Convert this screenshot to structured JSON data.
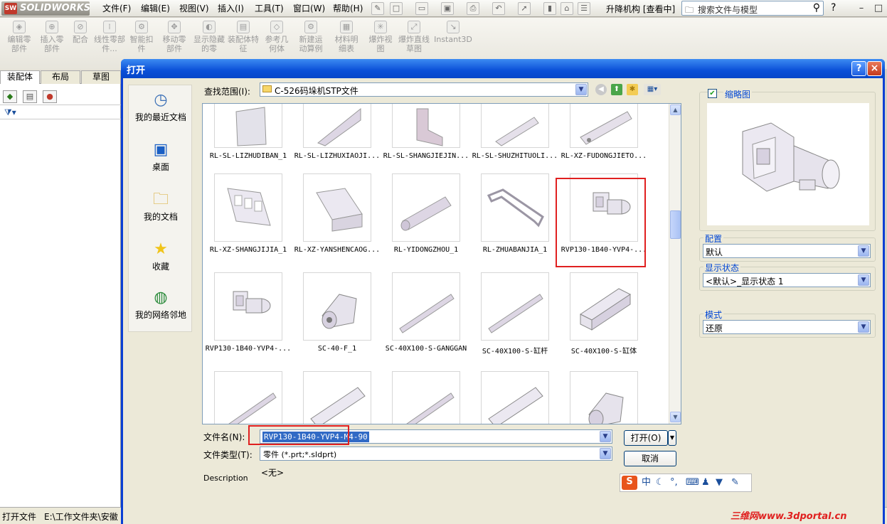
{
  "app": {
    "logo": "SOLIDWORKS",
    "menu": [
      "文件(F)",
      "编辑(E)",
      "视图(V)",
      "插入(I)",
      "工具(T)",
      "窗口(W)",
      "帮助(H)"
    ],
    "doc_title": "升降机构 [查看中]",
    "search_placeholder": "搜索文件与模型",
    "help_symbol": "?"
  },
  "commands": [
    {
      "label": "编辑零部件",
      "icon": "edit-component-icon"
    },
    {
      "label": "插入零部件",
      "icon": "insert-component-icon"
    },
    {
      "label": "配合",
      "icon": "mate-icon"
    },
    {
      "label": "线性零部件...",
      "icon": "linear-pattern-icon"
    },
    {
      "label": "智能扣件",
      "icon": "smart-fastener-icon"
    },
    {
      "label": "移动零部件",
      "icon": "move-component-icon"
    },
    {
      "label": "显示隐藏的零",
      "icon": "show-hidden-icon"
    },
    {
      "label": "装配体特征",
      "icon": "assembly-feature-icon"
    },
    {
      "label": "参考几何体",
      "icon": "reference-geometry-icon"
    },
    {
      "label": "新建运动算例",
      "icon": "motion-study-icon"
    },
    {
      "label": "材料明细表",
      "icon": "bom-icon"
    },
    {
      "label": "爆炸视图",
      "icon": "exploded-view-icon"
    },
    {
      "label": "爆炸直线草图",
      "icon": "explode-line-icon"
    },
    {
      "label": "Instant3D",
      "icon": "instant3d-icon"
    }
  ],
  "left_panel": {
    "tabs": [
      "装配体",
      "布局",
      "草图"
    ]
  },
  "status": {
    "left": "打开文件",
    "path": "E:\\工作文件夹\\安徽"
  },
  "dialog": {
    "title": "打开",
    "help": "?",
    "close": "×",
    "places": [
      {
        "label": "我的最近文档",
        "icon": "recent-documents-icon"
      },
      {
        "label": "桌面",
        "icon": "desktop-icon"
      },
      {
        "label": "我的文档",
        "icon": "my-documents-icon"
      },
      {
        "label": "收藏",
        "icon": "favorites-star-icon"
      },
      {
        "label": "我的网络邻地",
        "icon": "network-places-icon"
      }
    ],
    "lookin_label": "查找范围(I):",
    "lookin_value": "C-526码垛机STP文件",
    "files": [
      "RL-SL-LIZHUDIBAN_1",
      "RL-SL-LIZHUXIAOJI...",
      "RL-SL-SHANGJIEJIN...",
      "RL-SL-SHUZHITUOLI...",
      "RL-XZ-FUDONGJIETO...",
      "RL-XZ-SHANGJIJIA_1",
      "RL-XZ-YANSHENCAOG...",
      "RL-YIDONGZHOU_1",
      "RL-ZHUABANJIA_1",
      "RVP130-1B40-YVP4-...",
      "RVP130-1B40-YVP4-...",
      "SC-40-F_1",
      "SC-40X100-S-GANGGAN",
      "SC-40X100-S-缸杆",
      "SC-40X100-S-缸体"
    ],
    "filename_label": "文件名(N):",
    "filename_value": "RVP130-1B40-YVP4-M4-90",
    "filetype_label": "文件类型(T):",
    "filetype_value": "零件 (*.prt;*.sldprt)",
    "open_button": "打开(O)",
    "cancel_button": "取消",
    "description_label": "Description",
    "description_value": "<无>",
    "thumbnail_label": "缩略图",
    "config_label": "配置",
    "config_value": "默认",
    "display_state_label": "显示状态",
    "display_state_value": "<默认>_显示状态 1",
    "mode_label": "模式",
    "mode_value": "还原"
  },
  "ime": {
    "lang": "中"
  },
  "watermark": "三维网www.3dportal.cn",
  "colors": {
    "title_bar": "#0a4fd8",
    "highlight": "#e02020",
    "selection": "#316ac5"
  }
}
